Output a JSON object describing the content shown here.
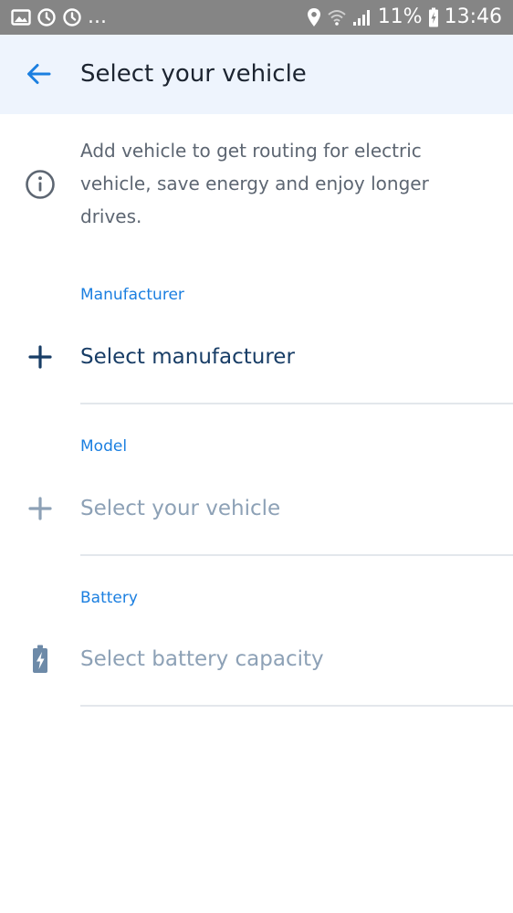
{
  "status_bar": {
    "left_icons": [
      "image-icon",
      "sync-icon",
      "sync-icon"
    ],
    "overflow": "...",
    "battery_percent": "11%",
    "time": "13:46"
  },
  "header": {
    "title": "Select your vehicle"
  },
  "info": {
    "text": "Add vehicle to get routing for electric vehicle, save energy and enjoy longer drives."
  },
  "sections": {
    "manufacturer": {
      "label": "Manufacturer",
      "placeholder": "Select manufacturer",
      "icon": "plus-icon"
    },
    "model": {
      "label": "Model",
      "placeholder": "Select your vehicle",
      "icon": "plus-icon"
    },
    "battery": {
      "label": "Battery",
      "placeholder": "Select battery capacity",
      "icon": "battery-charging-icon"
    }
  },
  "colors": {
    "status_bar": "#858585",
    "app_bar": "#eef4fd",
    "accent": "#1b7fe0",
    "active_text": "#183d66",
    "muted_text": "#8da1b6"
  }
}
